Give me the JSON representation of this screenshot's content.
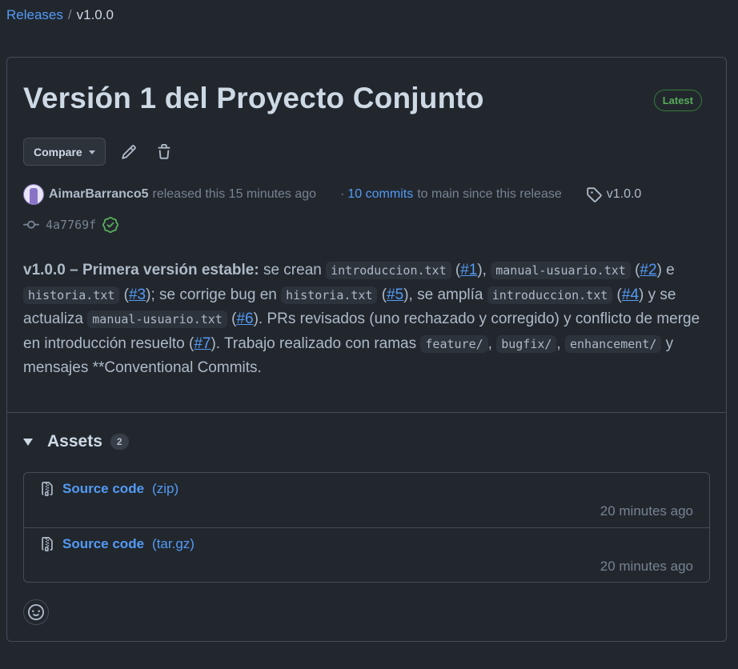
{
  "breadcrumb": {
    "releases": "Releases",
    "separator": "/",
    "current": "v1.0.0"
  },
  "release": {
    "title": "Versión 1 del Proyecto Conjunto",
    "badge": "Latest",
    "compare_label": "Compare",
    "author": "AimarBarranco5",
    "released_text": "released this 15 minutes ago",
    "commits_sep": "·",
    "commits_link": "10 commits",
    "commits_suffix": "to main since this release",
    "tag": "v1.0.0",
    "commit_sha": "4a7769f"
  },
  "notes": {
    "lead": "v1.0.0 – Primera versión estable:",
    "t1": " se crean ",
    "c1": "introduccion.txt",
    "t2": " (",
    "l1": "#1",
    "t3": "), ",
    "c2": "manual-usuario.txt",
    "t4": " (",
    "l2": "#2",
    "t5": ") e ",
    "c3": "historia.txt",
    "t6": " (",
    "l3": "#3",
    "t7": "); se corrige bug en ",
    "c4": "historia.txt",
    "t8": " (",
    "l4": "#5",
    "t9": "), se amplía ",
    "c5": "introduccion.txt",
    "t10": " (",
    "l5": "#4",
    "t11": ") y se actualiza ",
    "c6": "manual-usuario.txt",
    "t12": " (",
    "l6": "#6",
    "t13": "). PRs revisados (uno rechazado y corregido) y conflicto de merge en introducción resuelto (",
    "l7": "#7",
    "t14": "). Trabajo realizado con ramas ",
    "c7": "feature/",
    "t15": ", ",
    "c8": "bugfix/",
    "t16": ", ",
    "c9": "enhancement/",
    "t17": " y mensajes **Conventional Commits."
  },
  "assets": {
    "title": "Assets",
    "count": "2",
    "items": [
      {
        "name": "Source code",
        "ext": "(zip)",
        "time": "20 minutes ago"
      },
      {
        "name": "Source code",
        "ext": "(tar.gz)",
        "time": "20 minutes ago"
      }
    ]
  },
  "icons": {
    "edit": "pencil-icon",
    "delete": "trash-icon",
    "tag": "tag-icon",
    "commit": "git-commit-icon",
    "verified": "verified-check-icon",
    "archive": "file-zip-icon",
    "reaction": "smiley-icon"
  },
  "colors": {
    "accent": "#539bf5",
    "success": "#57ab5a",
    "background": "#22272e",
    "border": "#444c56"
  }
}
